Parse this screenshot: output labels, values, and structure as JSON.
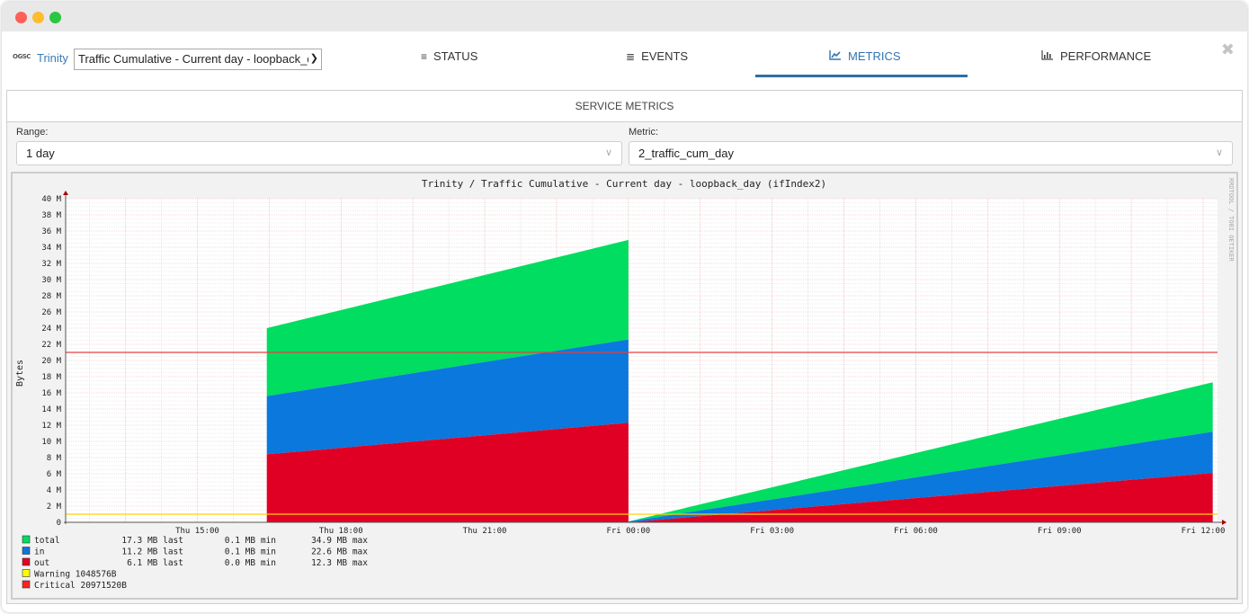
{
  "window": {
    "title_bar_buttons": [
      "close",
      "minimize",
      "zoom"
    ]
  },
  "topbar": {
    "logo": "OGSC",
    "host": "Trinity",
    "service_select": "Traffic Cumulative - Current day - loopback_d",
    "tabs": [
      {
        "label": "STATUS",
        "icon": "list-icon",
        "active": false
      },
      {
        "label": "EVENTS",
        "icon": "database-icon",
        "active": false
      },
      {
        "label": "METRICS",
        "icon": "line-chart-icon",
        "active": true
      },
      {
        "label": "PERFORMANCE",
        "icon": "bar-chart-icon",
        "active": false
      }
    ],
    "close_icon": "close-icon"
  },
  "panel": {
    "title": "SERVICE METRICS",
    "range_label": "Range:",
    "range_value": "1 day",
    "metric_label": "Metric:",
    "metric_value": "2_traffic_cum_day"
  },
  "colors": {
    "total": "#00dd60",
    "in": "#0a78dc",
    "out": "#e00024",
    "warning": "#ffff00",
    "critical": "#ff2020",
    "accent": "#3474b1"
  },
  "chart_data": {
    "type": "area",
    "stacked": true,
    "title": "Trinity / Traffic Cumulative - Current day - loopback_day (ifIndex2)",
    "ylabel": "Bytes",
    "xlabel": "",
    "watermark": "RRDTOOL / TOBI OETIKER",
    "ylim": [
      0,
      40
    ],
    "yunit": "M",
    "yticks": [
      "0",
      "2 M",
      "4 M",
      "6 M",
      "8 M",
      "10 M",
      "12 M",
      "14 M",
      "16 M",
      "18 M",
      "20 M",
      "22 M",
      "24 M",
      "26 M",
      "28 M",
      "30 M",
      "32 M",
      "34 M",
      "36 M",
      "38 M",
      "40 M"
    ],
    "xlim_hours": [
      12.25,
      36.3
    ],
    "xticks": [
      {
        "label": "Thu 15:00",
        "hour": 15
      },
      {
        "label": "Thu 18:00",
        "hour": 18
      },
      {
        "label": "Thu 21:00",
        "hour": 21
      },
      {
        "label": "Fri 00:00",
        "hour": 24
      },
      {
        "label": "Fri 03:00",
        "hour": 27
      },
      {
        "label": "Fri 06:00",
        "hour": 30
      },
      {
        "label": "Fri 09:00",
        "hour": 33
      },
      {
        "label": "Fri 12:00",
        "hour": 36
      }
    ],
    "segments": [
      {
        "x_hours": [
          16.45,
          24.0
        ],
        "out": [
          8.4,
          12.3
        ],
        "in": [
          7.2,
          10.3
        ],
        "total_extra": [
          8.4,
          12.3
        ]
      },
      {
        "x_hours": [
          24.0,
          36.2
        ],
        "out": [
          0.0,
          6.1
        ],
        "in": [
          0.1,
          5.1
        ],
        "total_extra": [
          0.0,
          6.1
        ]
      }
    ],
    "series": [
      {
        "name": "total",
        "last": "17.3 MB last",
        "min": "0.1 MB min",
        "max": "34.9 MB max"
      },
      {
        "name": "in",
        "last": "11.2 MB last",
        "min": "0.1 MB min",
        "max": "22.6 MB max"
      },
      {
        "name": "out",
        "last": "6.1 MB last",
        "min": "0.0 MB min",
        "max": "12.3 MB max"
      }
    ],
    "thresholds": [
      {
        "name": "Warning",
        "label": "Warning  1048576B",
        "value_M": 1.0
      },
      {
        "name": "Critical",
        "label": "Critical 20971520B",
        "value_M": 21.0
      }
    ],
    "grid": true,
    "legend_position": "bottom-left"
  }
}
